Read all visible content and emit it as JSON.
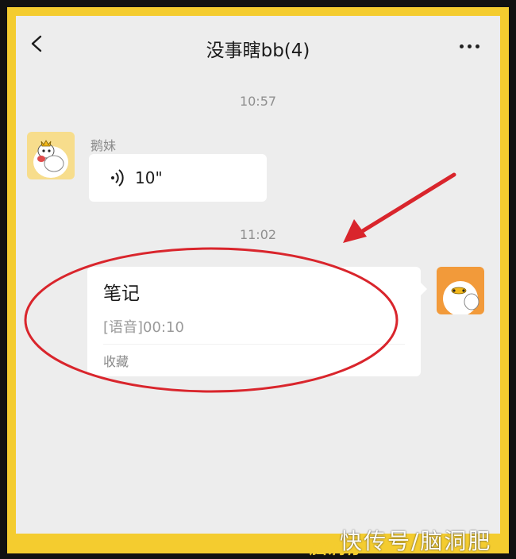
{
  "header": {
    "title": "没事瞎bb(4)"
  },
  "messages": [
    {
      "time": "10:57",
      "sender": "鹅妹",
      "type": "voice",
      "duration": "10\""
    },
    {
      "time": "11:02",
      "type": "favorite_note",
      "card_title": "笔记",
      "card_subtitle": "[语音]00:10",
      "card_footer": "收藏"
    }
  ],
  "watermark": {
    "brand": "脑洞仔",
    "text": "快传号/脑洞肥"
  },
  "colors": {
    "frame": "#f4cc2f",
    "annotation": "#d9252c",
    "background": "#ededed"
  }
}
